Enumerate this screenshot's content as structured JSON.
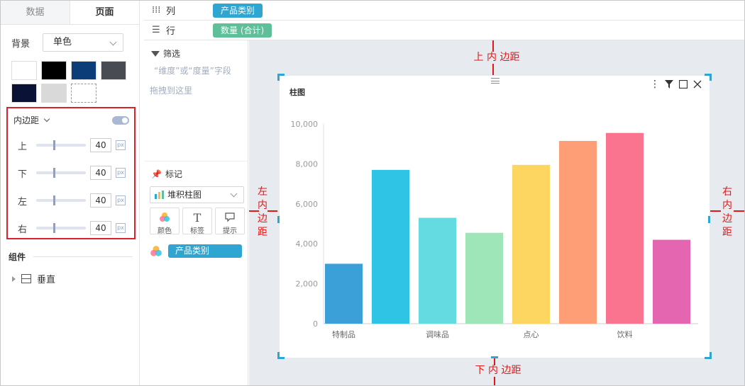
{
  "left_panel": {
    "tabs": [
      "数据",
      "页面"
    ],
    "background_label": "背景",
    "background_value": "单色",
    "swatches": [
      "#ffffff",
      "#000000",
      "#0c3d78",
      "#484b52",
      "#0a1236",
      "#d9d9d9",
      "transparent"
    ],
    "padding": {
      "title": "内边距",
      "enabled": true,
      "rows": [
        {
          "label": "上",
          "value": "40",
          "unit": "px"
        },
        {
          "label": "下",
          "value": "40",
          "unit": "px"
        },
        {
          "label": "左",
          "value": "40",
          "unit": "px"
        },
        {
          "label": "右",
          "value": "40",
          "unit": "px"
        }
      ]
    },
    "components_title": "组件",
    "component_item": "垂直"
  },
  "shelf": {
    "columns_label": "列",
    "columns_pill": "产品类别",
    "rows_label": "行",
    "rows_pill": "数量 (合计)"
  },
  "mid_panel": {
    "filter_title": "筛选",
    "filter_hint_1": "“维度”或“度量”字段",
    "filter_hint_2": "拖拽到这里",
    "mark_title": "标记",
    "mark_type": "堆积柱图",
    "buttons": [
      "颜色",
      "标签",
      "提示"
    ],
    "color_pill": "产品类别"
  },
  "card": {
    "title": "柱图"
  },
  "annotations": {
    "top": "上 内 边距",
    "bottom": "下 内 边距",
    "left": [
      "左",
      "内",
      "边",
      "距"
    ],
    "right": [
      "右",
      "内",
      "边",
      "距"
    ]
  },
  "chart_data": {
    "type": "bar",
    "categories": [
      "",
      "",
      "",
      "",
      "",
      "",
      "",
      ""
    ],
    "tick_labels": [
      "特制品",
      "",
      "调味品",
      "",
      "点心",
      "",
      "饮料",
      ""
    ],
    "values": [
      3000,
      7700,
      5300,
      4550,
      7950,
      9150,
      9550,
      4200
    ],
    "colors": [
      "#3ba0d8",
      "#2fc4e6",
      "#63dbe0",
      "#9ee5b8",
      "#fdd662",
      "#fe9e76",
      "#fa7490",
      "#e466b0"
    ],
    "title": "柱图",
    "xlabel": "",
    "ylabel": "",
    "ylim": [
      0,
      10000
    ],
    "yticks": [
      "0",
      "2,000",
      "4,000",
      "6,000",
      "8,000",
      "10,000"
    ],
    "grid": false
  }
}
